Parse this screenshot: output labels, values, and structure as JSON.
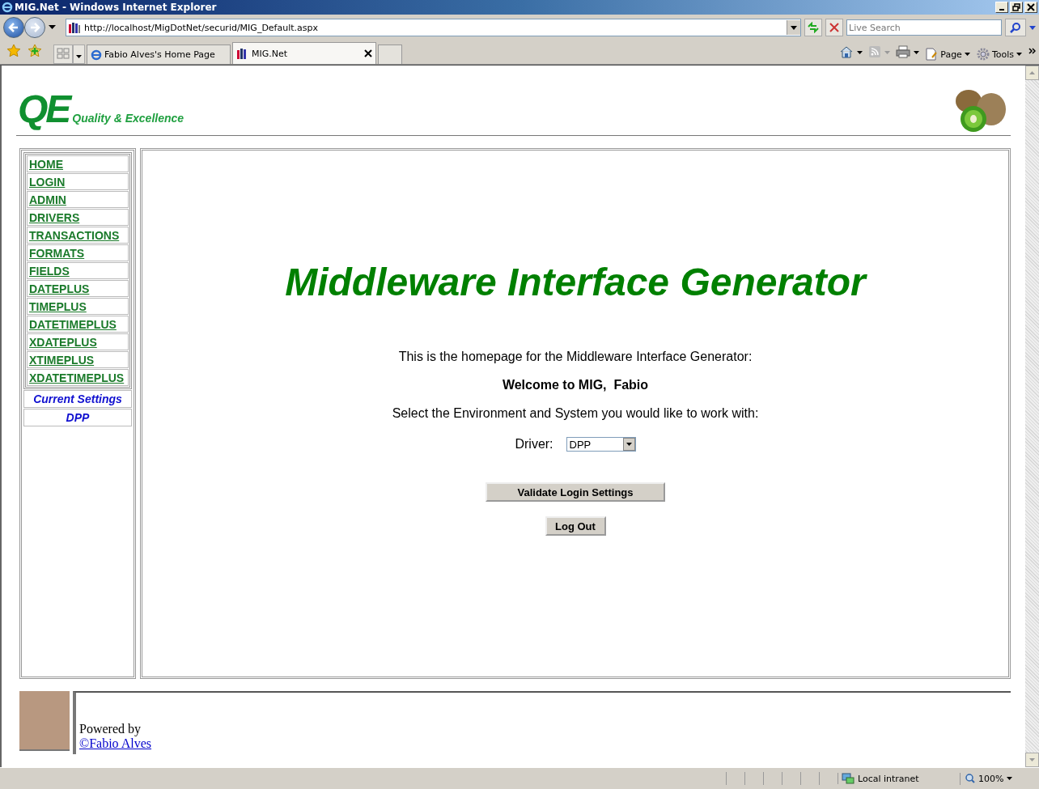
{
  "window": {
    "title": "MIG.Net - Windows Internet Explorer"
  },
  "address_bar": {
    "url": "http://localhost/MigDotNet/securid/MIG_Default.aspx"
  },
  "search": {
    "placeholder": "Live Search"
  },
  "tabs": [
    {
      "label": "Fabio Alves's Home Page",
      "selected": false
    },
    {
      "label": "MIG.Net",
      "selected": true
    }
  ],
  "command_bar": [
    "Page",
    "Tools"
  ],
  "header": {
    "logo": "QE",
    "tagline": "Quality & Excellence"
  },
  "nav": {
    "items": [
      "HOME",
      "LOGIN",
      "ADMIN",
      "DRIVERS",
      "TRANSACTIONS",
      "FORMATS",
      "FIELDS",
      "DATEPLUS",
      "TIMEPLUS",
      "DATETIMEPLUS",
      "XDATEPLUS",
      "XTIMEPLUS",
      "XDATETIMEPLUS"
    ],
    "settings_title": "Current Settings",
    "settings_value": "DPP"
  },
  "main": {
    "heading": "Middleware Interface Generator",
    "intro": "This is the homepage for the Middleware Interface Generator:",
    "welcome": "Welcome to MIG,  Fabio",
    "prompt": "Select the Environment and System you would like to work with:",
    "driver_label": "Driver:",
    "driver_value": "DPP",
    "buttons": [
      "Validate Login Settings",
      "Log Out"
    ]
  },
  "footer": {
    "powered_by": "Powered by",
    "author": "©Fabio Alves"
  },
  "status_bar": {
    "zone": "Local intranet",
    "zoom": "100%"
  }
}
